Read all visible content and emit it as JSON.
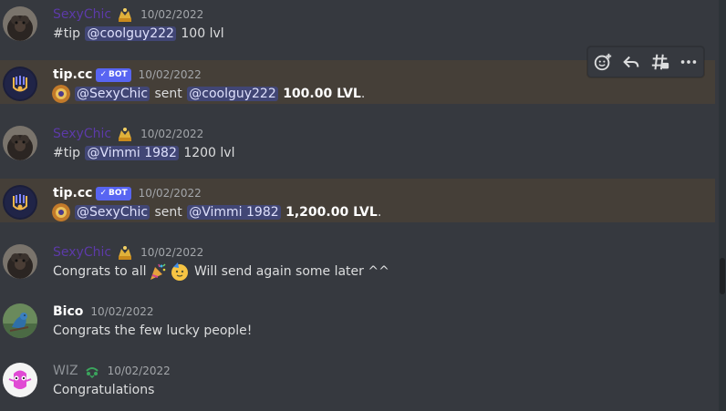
{
  "messages": [
    {
      "username": "SexyChic",
      "timestamp": "10/02/2022",
      "text_prefix": "#tip",
      "mention": "@coolguy222",
      "text_suffix": "100 lvl"
    },
    {
      "username": "tip.cc",
      "bot_tag": "BOT",
      "timestamp": "10/02/2022",
      "mention1": "@SexyChic",
      "sent_word": "sent",
      "mention2": "@coolguy222",
      "amount": "100.00 LVL",
      "end": "."
    },
    {
      "username": "SexyChic",
      "timestamp": "10/02/2022",
      "text_prefix": "#tip",
      "mention": "@Vimmi 1982",
      "text_suffix": "1200 lvl"
    },
    {
      "username": "tip.cc",
      "bot_tag": "BOT",
      "timestamp": "10/02/2022",
      "mention1": "@SexyChic",
      "sent_word": "sent",
      "mention2": "@Vimmi 1982",
      "amount": "1,200.00 LVL",
      "end": "."
    },
    {
      "username": "SexyChic",
      "timestamp": "10/02/2022",
      "text_before": "Congrats to all",
      "text_after": "Will send again some later ^^"
    },
    {
      "username": "Bico",
      "timestamp": "10/02/2022",
      "text": "Congrats the few lucky people!"
    },
    {
      "username": "WIZ",
      "timestamp": "10/02/2022",
      "text": "Congratulations"
    }
  ],
  "toolbar": {
    "icons": [
      "add-reaction-icon",
      "reply-icon",
      "create-thread-icon",
      "more-icon"
    ]
  },
  "colors": {
    "background": "#36393f",
    "highlight": "#453f38",
    "mention_bg": "#414675",
    "mention_text": "#dee0fc",
    "bot_tag": "#5865f2",
    "sexychic_name": "#5c3aa8"
  }
}
